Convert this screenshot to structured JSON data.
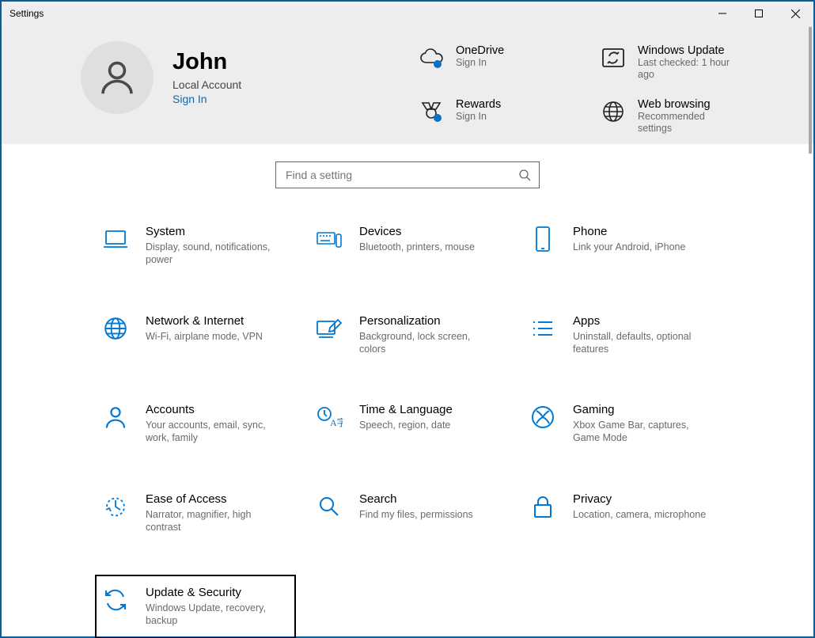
{
  "window": {
    "title": "Settings"
  },
  "profile": {
    "name": "John",
    "account_type": "Local Account",
    "sign_in": "Sign In"
  },
  "quick": {
    "onedrive": {
      "title": "OneDrive",
      "sub": "Sign In"
    },
    "windows_update": {
      "title": "Windows Update",
      "sub": "Last checked: 1 hour ago"
    },
    "rewards": {
      "title": "Rewards",
      "sub": "Sign In"
    },
    "web_browsing": {
      "title": "Web browsing",
      "sub": "Recommended settings"
    }
  },
  "search": {
    "placeholder": "Find a setting"
  },
  "categories": {
    "system": {
      "title": "System",
      "sub": "Display, sound, notifications, power"
    },
    "devices": {
      "title": "Devices",
      "sub": "Bluetooth, printers, mouse"
    },
    "phone": {
      "title": "Phone",
      "sub": "Link your Android, iPhone"
    },
    "network": {
      "title": "Network & Internet",
      "sub": "Wi-Fi, airplane mode, VPN"
    },
    "personalization": {
      "title": "Personalization",
      "sub": "Background, lock screen, colors"
    },
    "apps": {
      "title": "Apps",
      "sub": "Uninstall, defaults, optional features"
    },
    "accounts": {
      "title": "Accounts",
      "sub": "Your accounts, email, sync, work, family"
    },
    "time": {
      "title": "Time & Language",
      "sub": "Speech, region, date"
    },
    "gaming": {
      "title": "Gaming",
      "sub": "Xbox Game Bar, captures, Game Mode"
    },
    "ease": {
      "title": "Ease of Access",
      "sub": "Narrator, magnifier, high contrast"
    },
    "search_cat": {
      "title": "Search",
      "sub": "Find my files, permissions"
    },
    "privacy": {
      "title": "Privacy",
      "sub": "Location, camera, microphone"
    },
    "update": {
      "title": "Update & Security",
      "sub": "Windows Update, recovery, backup"
    }
  }
}
